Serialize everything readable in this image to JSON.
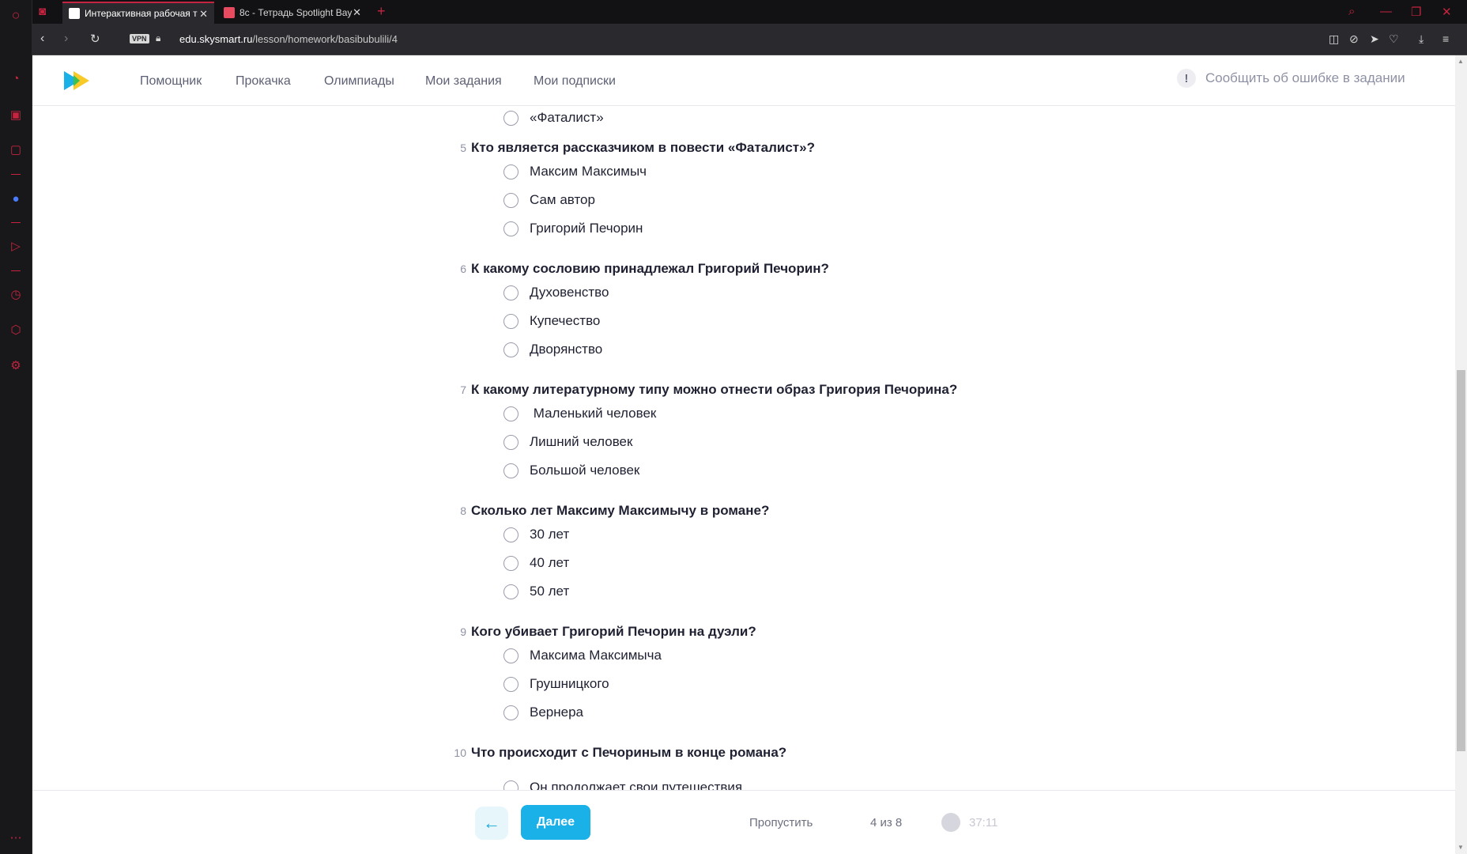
{
  "colors": {
    "accent": "#c4243f",
    "brand_blue": "#1ab0e8",
    "logo_yellow": "#f7c71c"
  },
  "browser": {
    "sidebar_icons": [
      "speed-dial-icon",
      "briefcase-icon",
      "twitch-icon",
      "messenger-icon",
      "player-icon",
      "history-icon",
      "box-icon",
      "settings-icon",
      "more-icon"
    ],
    "tabs": [
      {
        "title": "Интерактивная рабочая т",
        "active": true
      },
      {
        "title": "8с - Тетрадь Spotlight Bay",
        "active": false
      }
    ],
    "vpn_label": "VPN",
    "url_domain": "edu.skysmart.ru",
    "url_path": "/lesson/homework/basibubulili/4"
  },
  "header": {
    "nav": [
      "Помощник",
      "Прокачка",
      "Олимпиады",
      "Мои задания",
      "Мои подписки"
    ],
    "report_label": "Сообщить об ошибке в задании"
  },
  "quiz": {
    "prev_option": "«Фаталист»",
    "questions": [
      {
        "num": "5",
        "text": "Кто является рассказчиком в повести «Фаталист»?",
        "options": [
          "Максим Максимыч",
          "Сам автор",
          "Григорий Печорин"
        ]
      },
      {
        "num": "6",
        "text": "К какому сословию принадлежал Григорий Печорин?",
        "options": [
          "Духовенство",
          "Купечество",
          "Дворянство"
        ]
      },
      {
        "num": "7",
        "text": "К какому литературному типу можно отнести образ Григория Печорина?",
        "options": [
          " Маленький человек",
          "Лишний человек",
          "Большой человек"
        ]
      },
      {
        "num": "8",
        "text": "Сколько лет Максиму Максимычу в романе?",
        "options": [
          "30 лет",
          "40 лет",
          "50 лет"
        ]
      },
      {
        "num": "9",
        "text": "Кого убивает Григорий Печорин на дуэли?",
        "options": [
          "Максима Максимыча",
          "Грушницкого",
          "Вернера"
        ]
      },
      {
        "num": "10",
        "text": "Что происходит с Печориным в конце романа?",
        "options": [
          "Он продолжает свои путешествия"
        ]
      }
    ]
  },
  "footer": {
    "next_label": "Далее",
    "skip_label": "Пропустить",
    "pager": "4 из 8",
    "timer": "37:11"
  }
}
